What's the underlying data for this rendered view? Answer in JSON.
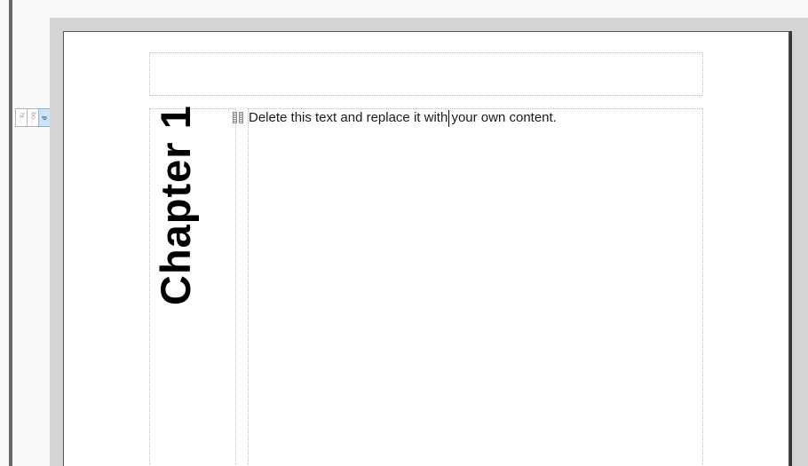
{
  "tag_strip": {
    "tags": [
      "ht...",
      "bo...",
      "p"
    ],
    "active_index": 2
  },
  "page": {
    "chapter_heading": "Chapter 1",
    "content_text": "Delete this text and replace it with your own content."
  },
  "colors": {
    "canvas_background": "#d4d4d4",
    "page_background": "#ffffff",
    "active_tag": "#cfe3f6",
    "region_border": "#bcbcbc"
  },
  "icons": [
    "drag-handle-icon",
    "text-caret"
  ]
}
